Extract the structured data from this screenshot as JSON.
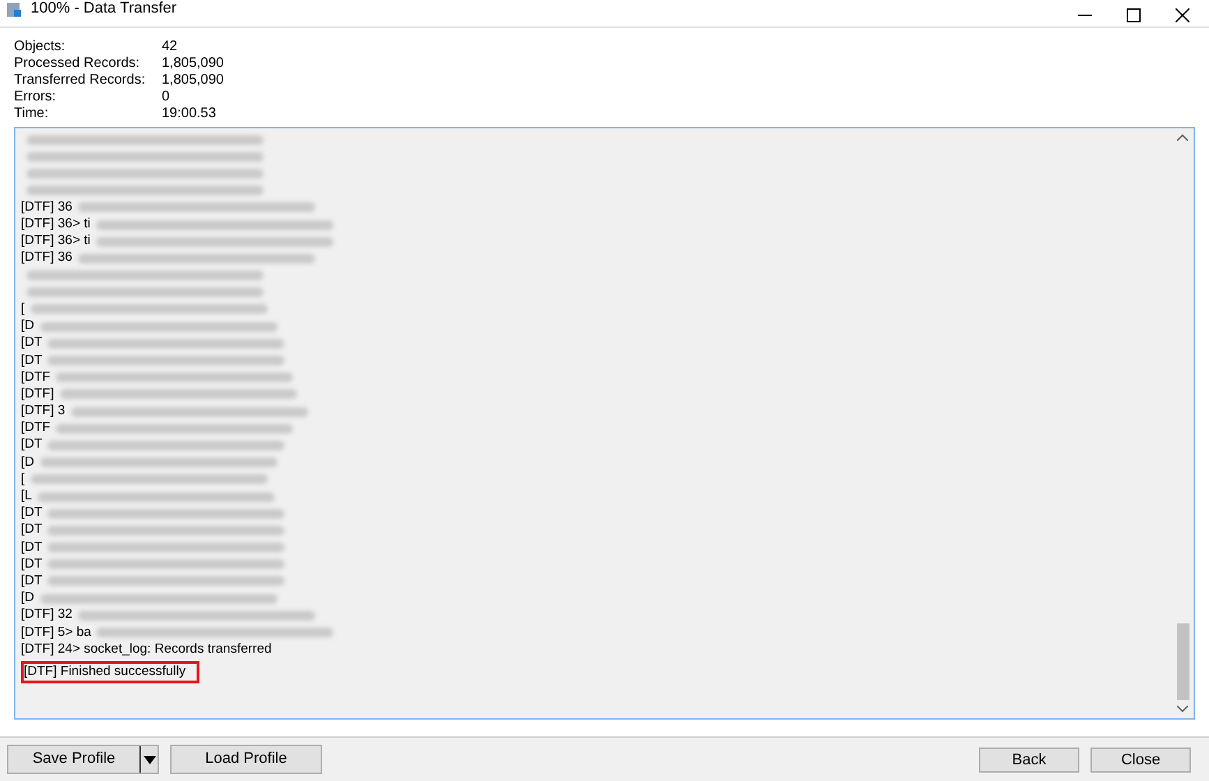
{
  "window": {
    "title": "100% - Data Transfer"
  },
  "stats": [
    {
      "label": "Objects:",
      "value": "42"
    },
    {
      "label": "Processed Records:",
      "value": "1,805,090"
    },
    {
      "label": "Transferred Records:",
      "value": "1,805,090"
    },
    {
      "label": "Errors:",
      "value": "0"
    },
    {
      "label": "Time:",
      "value": "19:00.53"
    }
  ],
  "log": [
    {
      "blurred": true
    },
    {
      "blurred": true
    },
    {
      "blurred": true
    },
    {
      "blurred": true
    },
    {
      "text": "[DTF] 36",
      "blurred": true
    },
    {
      "text": "[DTF] 36> ti",
      "blurred": true
    },
    {
      "text": "[DTF] 36> ti",
      "blurred": true
    },
    {
      "text": "[DTF] 36",
      "blurred": true
    },
    {
      "blurred": true
    },
    {
      "blurred": true
    },
    {
      "text": "[",
      "blurred": true
    },
    {
      "text": "[D",
      "blurred": true
    },
    {
      "text": "[DT",
      "blurred": true
    },
    {
      "text": "[DT",
      "blurred": true
    },
    {
      "text": "[DTF",
      "blurred": true
    },
    {
      "text": "[DTF]",
      "blurred": true
    },
    {
      "text": "[DTF] 3",
      "blurred": true
    },
    {
      "text": "[DTF",
      "blurred": true
    },
    {
      "text": "[DT",
      "blurred": true
    },
    {
      "text": "[D",
      "blurred": true
    },
    {
      "text": "[",
      "blurred": true
    },
    {
      "text": "[L",
      "blurred": true
    },
    {
      "text": "[DT",
      "blurred": true
    },
    {
      "text": "[DT",
      "blurred": true
    },
    {
      "text": "[DT",
      "blurred": true
    },
    {
      "text": "[DT",
      "blurred": true
    },
    {
      "text": "[DT",
      "blurred": true
    },
    {
      "text": "[D",
      "blurred": true
    },
    {
      "text": "[DTF] 32",
      "blurred": true
    },
    {
      "text": "[DTF] 5> ba",
      "blurred": true
    },
    {
      "text": "[DTF] 24> socket_log: Records transferred"
    },
    {
      "text": "[DTF] Finished successfully",
      "highlighted": true
    }
  ],
  "buttons_left": [
    {
      "label": "Save Profile",
      "kind": "split"
    },
    {
      "label": "Load Profile",
      "kind": "plain"
    }
  ],
  "buttons_right": [
    {
      "label": "Back"
    },
    {
      "label": "Close"
    }
  ]
}
